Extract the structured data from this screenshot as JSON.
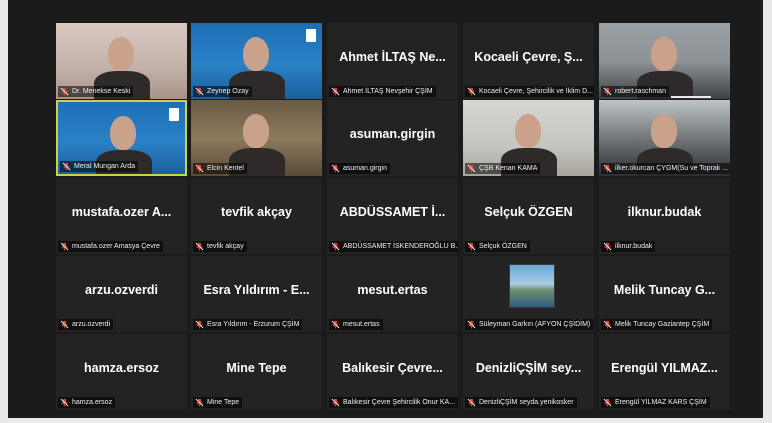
{
  "participants": [
    {
      "caption": "Dr. Menekse Keski",
      "display": "",
      "video": "pink"
    },
    {
      "caption": "Zeynep Ozay",
      "display": "",
      "video": "blue"
    },
    {
      "caption": "Ahmet İLTAŞ Nevşehir ÇŞİM",
      "display": "Ahmet İLTAŞ Ne...",
      "video": ""
    },
    {
      "caption": "Kocaeli Çevre, Şehircilik ve İklim D...",
      "display": "Kocaeli Çevre, Ş...",
      "video": ""
    },
    {
      "caption": "robert.raschman",
      "display": "",
      "video": "gray"
    },
    {
      "caption": "Meral Mungan Arda",
      "display": "",
      "video": "blue"
    },
    {
      "caption": "Elcin Kentel",
      "display": "",
      "video": "room"
    },
    {
      "caption": "asuman.girgin",
      "display": "asuman.girgin",
      "video": ""
    },
    {
      "caption": "ÇŞB Kenan KAMA",
      "display": "",
      "video": "office"
    },
    {
      "caption": "ilker.okurcan ÇYGM(Su ve Toprak ...",
      "display": "",
      "video": "dark"
    },
    {
      "caption": "mustafa.ozer Amasya Çevre",
      "display": "mustafa.ozer A...",
      "video": ""
    },
    {
      "caption": "tevfik akçay",
      "display": "tevfik akçay",
      "video": ""
    },
    {
      "caption": "ABDÜSSAMET İSKENDEROĞLU B...",
      "display": "ABDÜSSAMET İ...",
      "video": ""
    },
    {
      "caption": "Selçuk ÖZGEN",
      "display": "Selçuk ÖZGEN",
      "video": ""
    },
    {
      "caption": "ilknur.budak",
      "display": "ilknur.budak",
      "video": ""
    },
    {
      "caption": "arzu.ozverdi",
      "display": "arzu.ozverdi",
      "video": ""
    },
    {
      "caption": "Esra Yıldırım - Erzurum ÇŞİM",
      "display": "Esra Yıldırım - E...",
      "video": ""
    },
    {
      "caption": "mesut.ertas",
      "display": "mesut.ertas",
      "video": ""
    },
    {
      "caption": "Süleyman Garkın (AFYON ÇŞİDİM)",
      "display": "",
      "video": "thumb"
    },
    {
      "caption": "Melik Tuncay Gaziantep ÇŞİM",
      "display": "Melik Tuncay G...",
      "video": ""
    },
    {
      "caption": "hamza.ersoz",
      "display": "hamza.ersoz",
      "video": ""
    },
    {
      "caption": "Mine Tepe",
      "display": "Mine Tepe",
      "video": ""
    },
    {
      "caption": "Balıkesir Çevre Şehircilik Onur KA...",
      "display": "Balıkesir Çevre...",
      "video": ""
    },
    {
      "caption": "DenizliÇŞİM seyda.yenikosker",
      "display": "DenizliÇŞİM sey...",
      "video": ""
    },
    {
      "caption": "Erengül YILMAZ KARS ÇŞİM",
      "display": "Erengül YILMAZ...",
      "video": ""
    }
  ],
  "active_speaker_index": 5,
  "colors": {
    "mic_muted": "#e0483d",
    "active_border": "#c8d24a",
    "tile_bg": "#232323"
  },
  "icons": {
    "mic": "muted-microphone-icon"
  }
}
